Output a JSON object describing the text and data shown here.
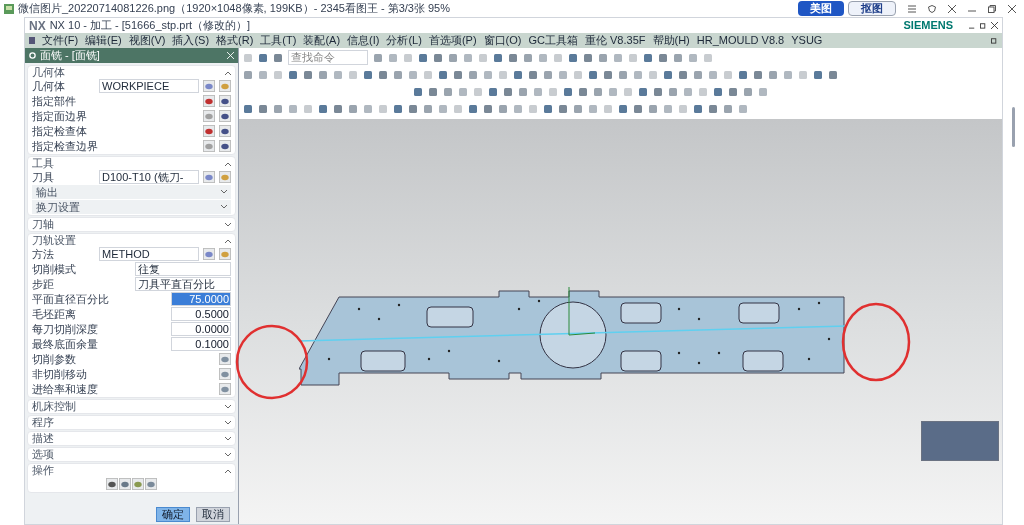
{
  "viewer": {
    "title": "微信图片_20220714081226.png（1920×1048像素, 199KB）- 2345看图王 - 第3/3张 95%",
    "buttons": [
      {
        "label": "美图",
        "selected": true
      },
      {
        "label": "抠图",
        "selected": false
      }
    ]
  },
  "nx": {
    "title": "NX 10 - 加工 - [51666_stp.prt（修改的）]",
    "logo": "NX",
    "brand": "SIEMENS",
    "menu": [
      "文件(F)",
      "编辑(E)",
      "视图(V)",
      "插入(S)",
      "格式(R)",
      "工具(T)",
      "装配(A)",
      "信息(I)",
      "分析(L)",
      "首选项(P)",
      "窗口(O)",
      "GC工具箱",
      "重伦 V8.35F",
      "帮助(H)",
      "HR_MOULD V8.8",
      "YSUG"
    ],
    "search": {
      "placeholder": "查找命令"
    }
  },
  "dialog": {
    "title": "面铣 - [面铣]",
    "sections": [
      {
        "title": "几何体",
        "expanded": true,
        "rows": [
          {
            "kind": "select",
            "label": "几何体",
            "value": "WORKPIECE"
          },
          {
            "kind": "icons",
            "label": "指定部件"
          },
          {
            "kind": "icons",
            "label": "指定面边界"
          },
          {
            "kind": "icons",
            "label": "指定检查体"
          },
          {
            "kind": "icons",
            "label": "指定检查边界"
          }
        ]
      },
      {
        "title": "工具",
        "expanded": true,
        "rows": [
          {
            "kind": "select",
            "label": "刀具",
            "value": "D100-T10 (铣刀-"
          },
          {
            "kind": "sub",
            "label": "输出"
          },
          {
            "kind": "sub",
            "label": "换刀设置"
          }
        ]
      },
      {
        "title": "刀轴",
        "expanded": false
      },
      {
        "title": "刀轨设置",
        "expanded": true,
        "rows": [
          {
            "kind": "select",
            "label": "方法",
            "value": "METHOD"
          },
          {
            "kind": "wide",
            "label": "切削模式",
            "value": "往复"
          },
          {
            "kind": "wide",
            "label": "步距",
            "value": "刀具平直百分比"
          },
          {
            "kind": "number",
            "label": "平面直径百分比",
            "value": "75.0000",
            "selected": true
          },
          {
            "kind": "number",
            "label": "毛坯距离",
            "value": "0.5000",
            "selected": false
          },
          {
            "kind": "number",
            "label": "每刀切削深度",
            "value": "0.0000",
            "selected": false
          },
          {
            "kind": "number",
            "label": "最终底面余量",
            "value": "0.1000",
            "selected": false
          },
          {
            "kind": "button",
            "label": "切削参数"
          },
          {
            "kind": "button",
            "label": "非切削移动"
          },
          {
            "kind": "button",
            "label": "进给率和速度"
          }
        ]
      },
      {
        "title": "机床控制",
        "expanded": false
      },
      {
        "title": "程序",
        "expanded": false
      },
      {
        "title": "描述",
        "expanded": false
      },
      {
        "title": "选项",
        "expanded": false
      },
      {
        "title": "操作",
        "expanded": true,
        "rows": [
          {
            "kind": "actions"
          }
        ]
      }
    ],
    "buttons": [
      {
        "label": "确定",
        "selected": true
      },
      {
        "label": "取消",
        "selected": false
      }
    ]
  }
}
